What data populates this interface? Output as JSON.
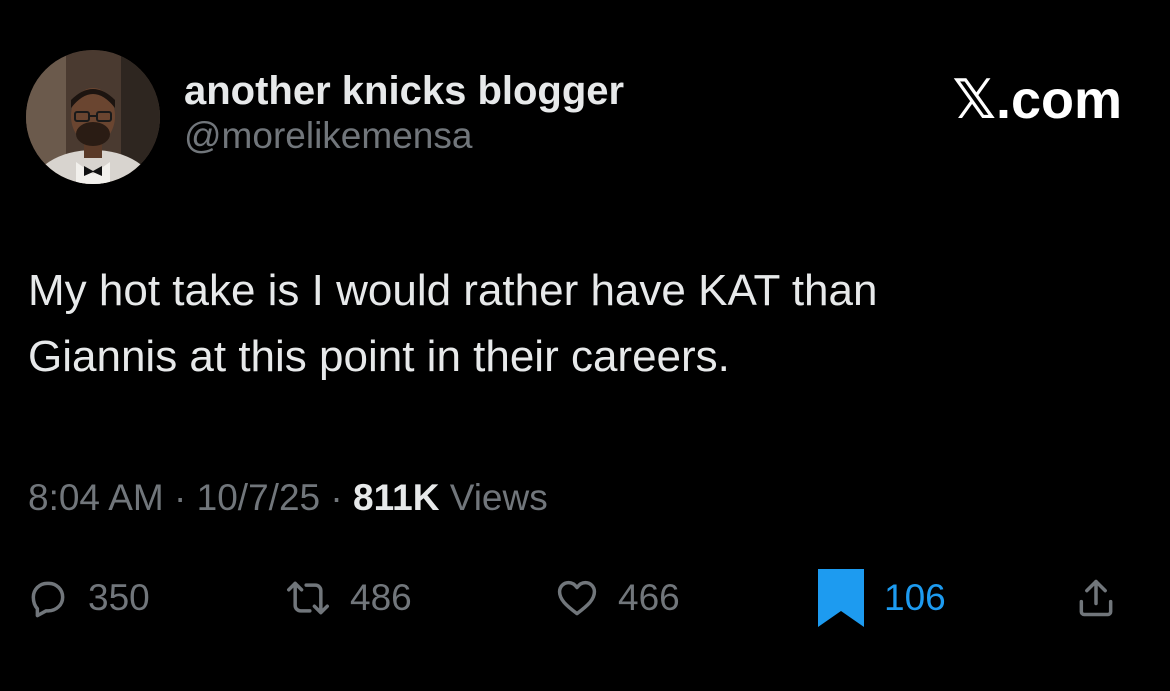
{
  "author": {
    "display_name": "another knicks blogger",
    "handle": "@morelikemensa"
  },
  "brand": "𝕏.com",
  "tweet": {
    "lines": [
      "My hot take is I would rather have KAT than",
      "Giannis at this point in their careers."
    ]
  },
  "meta": {
    "time": "8:04 AM",
    "separator": " · ",
    "date": "10/7/25",
    "views_count": "811K",
    "views_label": " Views"
  },
  "actions": {
    "replies": "350",
    "reposts": "486",
    "likes": "466",
    "bookmarks": "106"
  },
  "icons": {
    "reply": "reply-icon",
    "repost": "repost-icon",
    "like": "heart-icon",
    "bookmark": "bookmark-icon",
    "share": "share-icon"
  },
  "colors": {
    "background": "#000000",
    "primary_text": "#e7e9ea",
    "secondary_text": "#71767b",
    "accent": "#1d9bf0"
  }
}
